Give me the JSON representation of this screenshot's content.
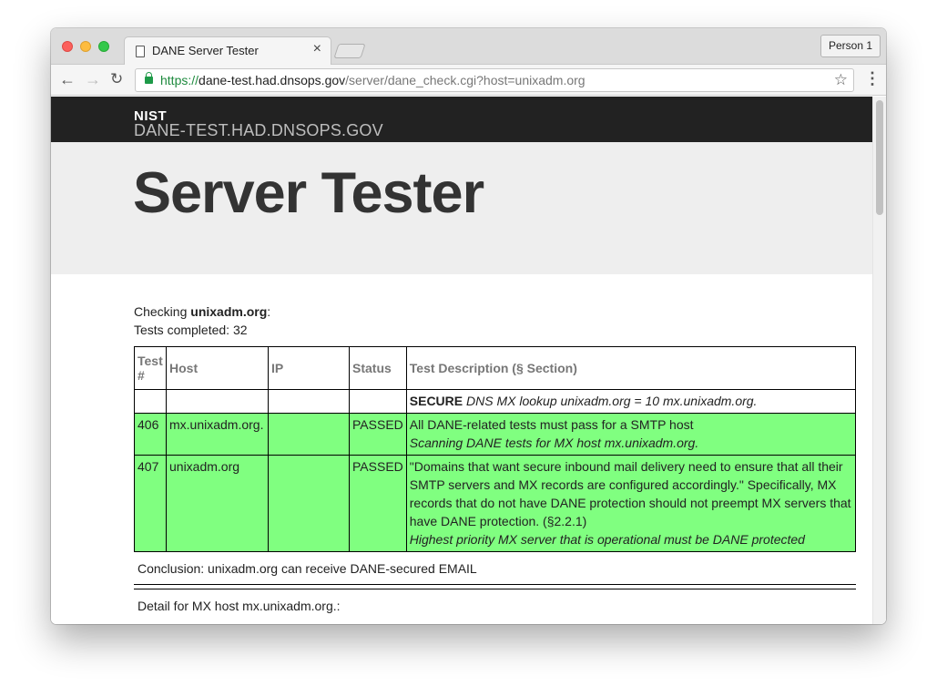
{
  "browser": {
    "tab_title": "DANE Server Tester",
    "profile_label": "Person 1",
    "url_scheme": "https://",
    "url_host": "dane-test.had.dnsops.gov",
    "url_path": "/server/dane_check.cgi?host=unixadm.org"
  },
  "site": {
    "logo_text": "NIST",
    "name": "DANE-TEST.HAD.DNSOPS.GOV"
  },
  "page": {
    "title": "Server Tester",
    "checking_prefix": "Checking ",
    "checking_host": "unixadm.org",
    "checking_suffix": ":",
    "tests_completed": "Tests completed: 32"
  },
  "table": {
    "headers": {
      "num": "Test #",
      "host": "Host",
      "ip": "IP",
      "status": "Status",
      "desc": "Test Description (§ Section)"
    },
    "rows": [
      {
        "num": "",
        "host": "",
        "ip": "",
        "status": "",
        "desc_bold": "SECURE",
        "desc_text": "",
        "desc_italic": "DNS MX lookup unixadm.org = 10 mx.unixadm.org.",
        "passed": false
      },
      {
        "num": "406",
        "host": "mx.unixadm.org.",
        "ip": "",
        "status": "PASSED",
        "desc_bold": "",
        "desc_text": "All DANE-related tests must pass for a SMTP host",
        "desc_italic": "Scanning DANE tests for MX host mx.unixadm.org.",
        "passed": true
      },
      {
        "num": "407",
        "host": "unixadm.org",
        "ip": "",
        "status": "PASSED",
        "desc_bold": "",
        "desc_text": "\"Domains that want secure inbound mail delivery need to ensure that all their SMTP servers and MX records are configured accordingly.\" Specifically, MX records that do not have DANE protection should not preempt MX servers that have DANE protection. (§2.2.1)",
        "desc_italic": "Highest priority MX server that is operational must be DANE protected",
        "passed": true
      }
    ]
  },
  "conclusion": "Conclusion: unixadm.org can receive DANE-secured EMAIL",
  "detail": "Detail for MX host mx.unixadm.org.:",
  "colors": {
    "pass_row": "#80ff80",
    "banner_bg": "#222222",
    "hero_bg": "#eeeeee"
  }
}
